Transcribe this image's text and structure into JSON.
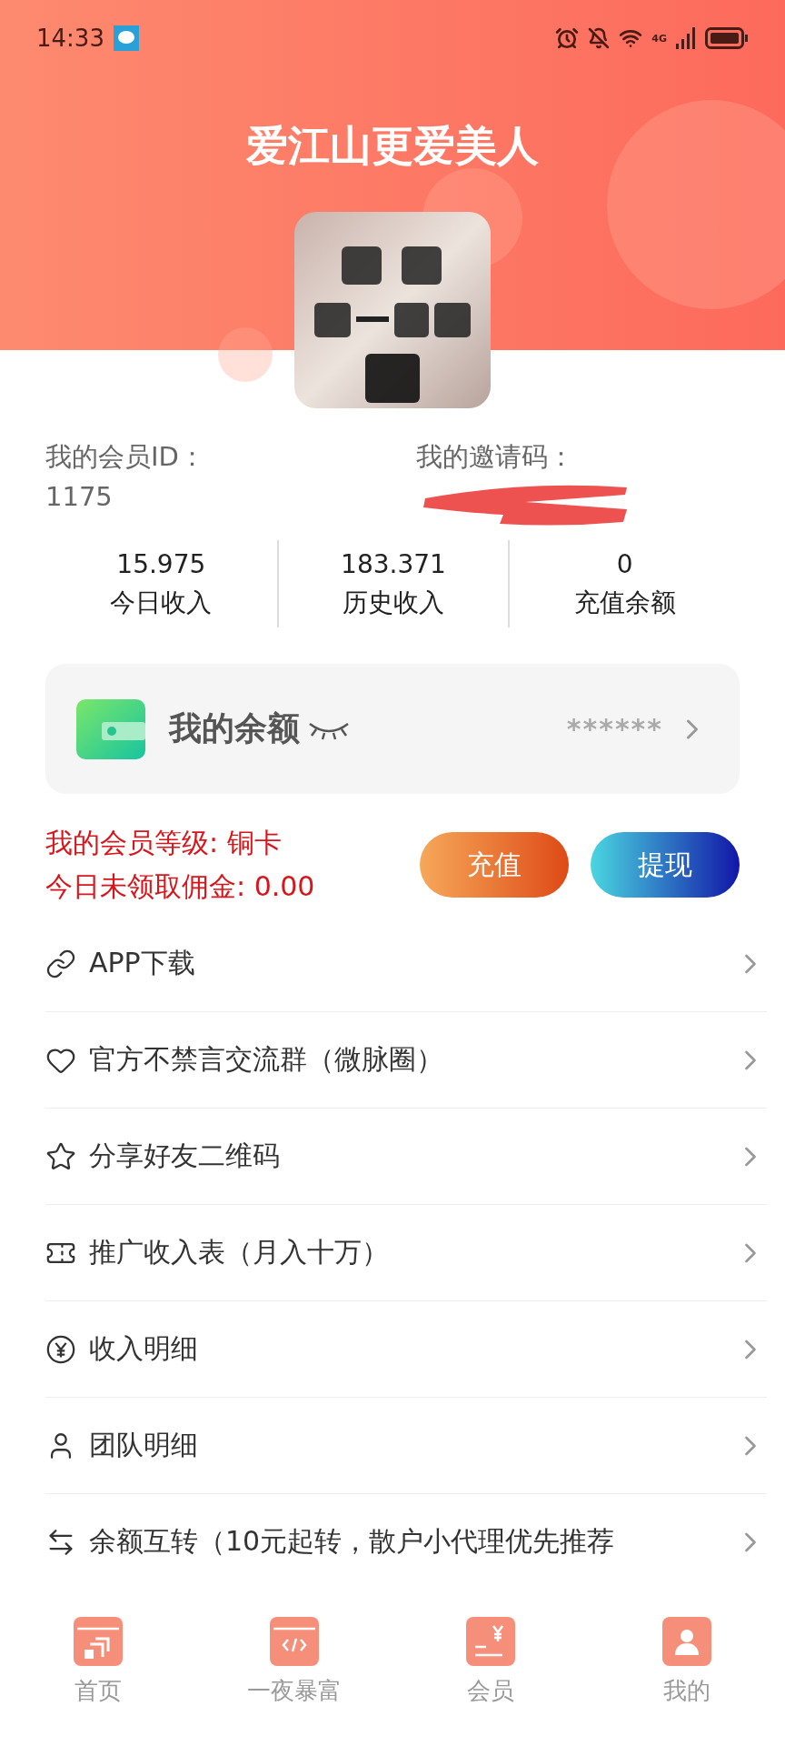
{
  "status_bar": {
    "time": "14:33",
    "network": "4G"
  },
  "header": {
    "title": "爱江山更爱美人"
  },
  "member": {
    "id_label": "我的会员ID：",
    "id_value": "1175",
    "invite_label": "我的邀请码：",
    "invite_redacted": true
  },
  "stats": [
    {
      "value": "15.975",
      "label": "今日收入"
    },
    {
      "value": "183.371",
      "label": "历史收入"
    },
    {
      "value": "0",
      "label": "充值余额"
    }
  ],
  "balance_card": {
    "title": "我的余额",
    "masked_value": "******",
    "hidden": true
  },
  "level": {
    "grade": "我的会员等级: 铜卡",
    "commission": "今日未领取佣金: 0.00"
  },
  "buttons": [
    {
      "label": "充值",
      "kind": "recharge"
    },
    {
      "label": "提现",
      "kind": "withdraw"
    }
  ],
  "menu": [
    {
      "label": "APP下载"
    },
    {
      "label": "官方不禁言交流群（微脉圈）"
    },
    {
      "label": "分享好友二维码"
    },
    {
      "label": "推广收入表（月入十万）"
    },
    {
      "label": "收入明细"
    },
    {
      "label": "团队明细"
    },
    {
      "label": "余额互转（10元起转，散户小代理优先推荐"
    }
  ],
  "tab_bar": [
    {
      "label": "首页"
    },
    {
      "label": "一夜暴富"
    },
    {
      "label": "会员"
    },
    {
      "label": "我的"
    }
  ]
}
